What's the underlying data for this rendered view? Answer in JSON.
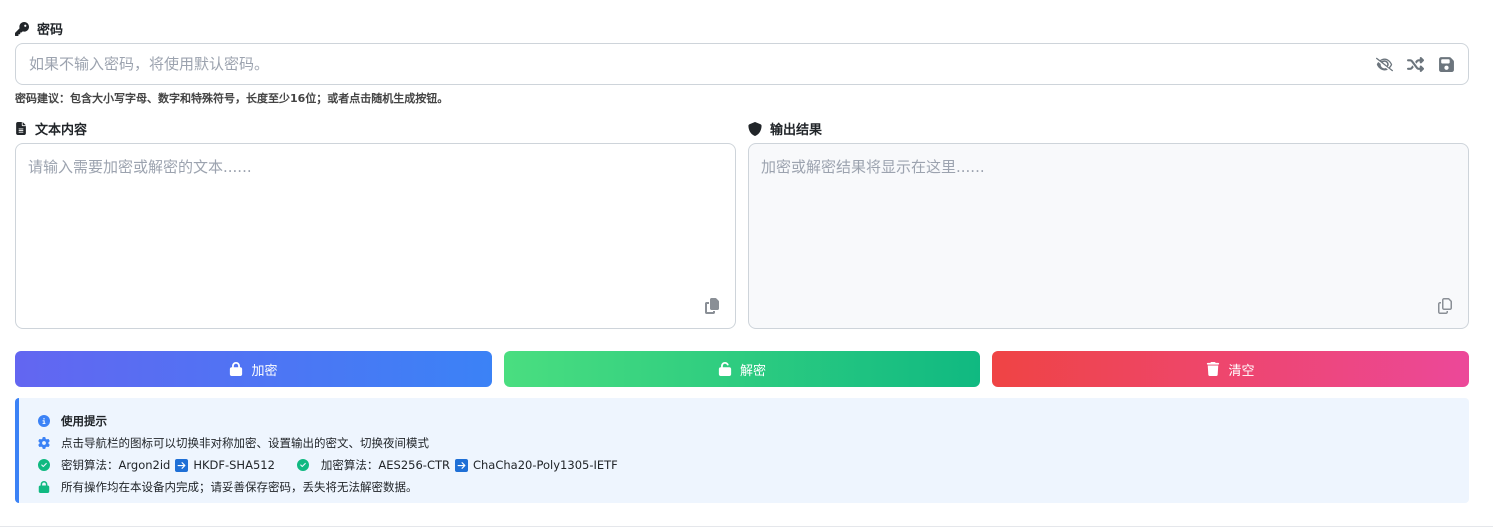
{
  "password": {
    "label": "密码",
    "placeholder": "如果不输入密码，将使用默认密码。",
    "value": "",
    "hint": "密码建议：包含大小写字母、数字和特殊符号，长度至少16位；或者点击随机生成按钮。",
    "icons": [
      "eye-slash-icon",
      "shuffle-icon",
      "save-icon"
    ]
  },
  "input_text": {
    "label": "文本内容",
    "placeholder": "请输入需要加密或解密的文本......",
    "value": ""
  },
  "output": {
    "label": "输出结果",
    "placeholder": "加密或解密结果将显示在这里......",
    "value": ""
  },
  "buttons": {
    "encrypt": "加密",
    "decrypt": "解密",
    "clear": "清空"
  },
  "tips": {
    "title": "使用提示",
    "line1": "点击导航栏的图标可以切换非对称加密、设置输出的密文、切换夜间模式",
    "kdf_label": "密钥算法：Argon2id",
    "kdf_next": "HKDF-SHA512",
    "cipher_label": "加密算法：AES256-CTR",
    "cipher_next": "ChaCha20-Poly1305-IETF",
    "line4": "所有操作均在本设备内完成；请妥善保存密码，丢失将无法解密数据。"
  },
  "colors": {
    "encrypt": [
      "#6366f1",
      "#3b82f6"
    ],
    "decrypt": [
      "#4ade80",
      "#10b981"
    ],
    "clear": [
      "#ef4444",
      "#ec4899"
    ],
    "tips_bg": "#eef5fe",
    "tips_border": "#3b82f6",
    "check": "#10b981"
  }
}
